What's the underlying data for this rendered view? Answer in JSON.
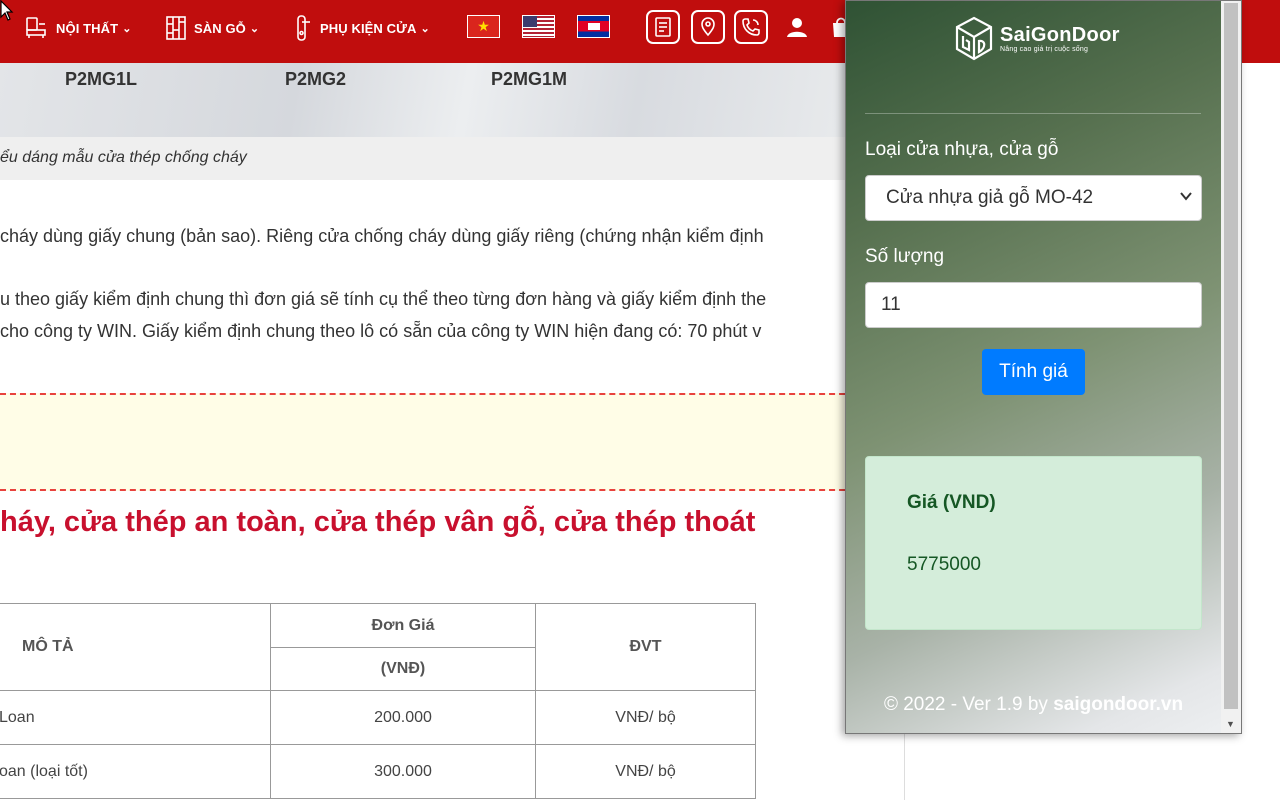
{
  "nav": {
    "items": [
      {
        "label": "NỘI THẤT"
      },
      {
        "label": "SÀN GỖ"
      },
      {
        "label": "PHỤ KIỆN CỬA"
      }
    ],
    "chevron": "⌵"
  },
  "products": [
    "P2MG1L",
    "P2MG2",
    "P2MG1M"
  ],
  "caption": "ểu dáng mẫu cửa thép chống cháy",
  "paragraphs": [
    "cháy dùng giấy chung (bản sao). Riêng cửa chống cháy dùng giấy riêng (chứng nhận kiểm định",
    "u theo giấy kiểm định chung thì đơn giá sẽ tính cụ thể theo từng đơn hàng và giấy kiểm định the",
    " cho công ty WIN. Giấy kiểm định chung theo lô có sẵn của công ty WIN hiện đang có: 70 phút v"
  ],
  "heading": "háy, cửa thép an toàn, cửa thép vân gỗ, cửa thép thoát",
  "table": {
    "col_desc": "MÔ TẢ",
    "col_price": "Đơn Giá",
    "col_price_unit": "(VNĐ)",
    "col_unit": "ĐVT",
    "rows": [
      {
        "desc": "Loan",
        "price": "200.000",
        "unit": "VNĐ/ bộ"
      },
      {
        "desc": "oan (loại tốt)",
        "price": "300.000",
        "unit": "VNĐ/ bộ"
      }
    ]
  },
  "popup": {
    "logo_title": "SaiGonDoor",
    "logo_tagline": "Nâng cao giá trị cuộc sống",
    "door_label": "Loại cửa nhựa, cửa gỗ",
    "door_selected": "Cửa nhựa giả gỗ MO-42",
    "qty_label": "Số lượng",
    "qty_value": "11",
    "calc_button": "Tính giá",
    "price_label": "Giá (VND)",
    "price_value": "5775000",
    "footer_prefix": "© 2022 - Ver 1.9 by ",
    "footer_site": "saigondoor.vn"
  },
  "colors": {
    "nav_bg": "#c00d0d",
    "heading": "#c8102e",
    "button": "#007bff",
    "result_bg": "#d4edda"
  }
}
